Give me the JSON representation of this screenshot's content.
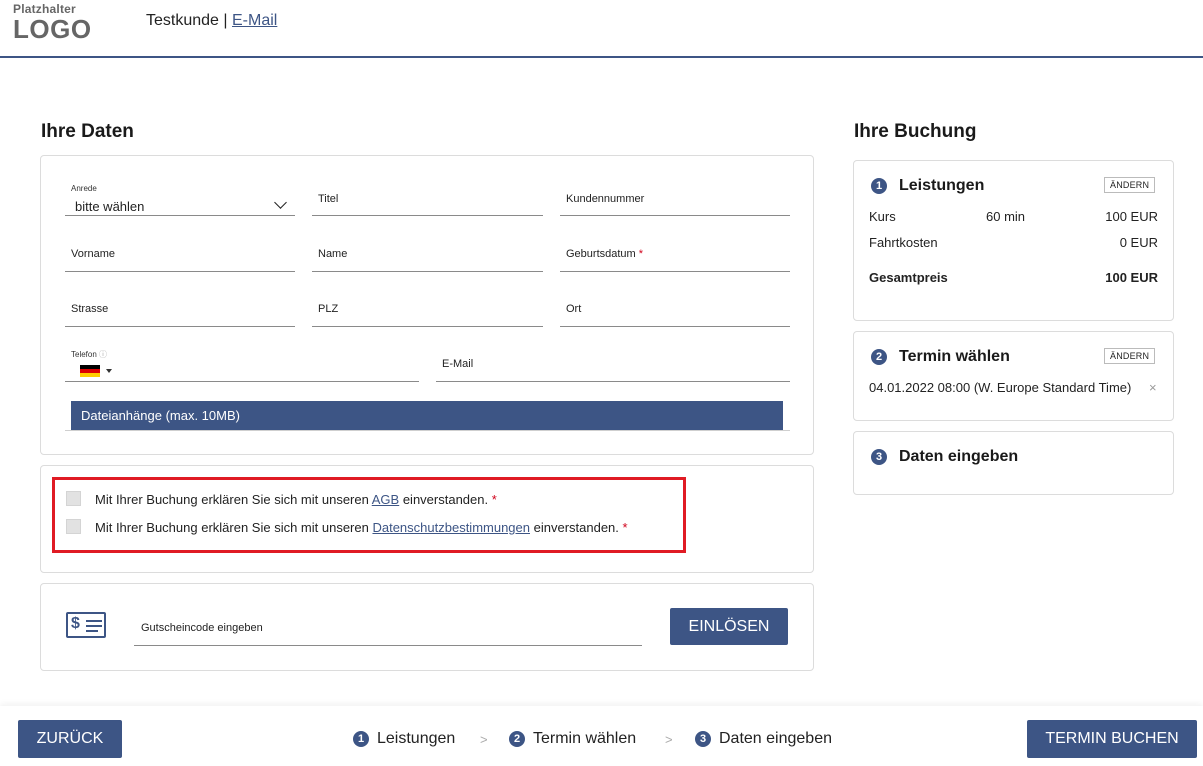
{
  "header": {
    "logo_line1": "Platzhalter",
    "logo_line2": "LOGO",
    "customer": "Testkunde",
    "separator": "|",
    "email_link": "E-Mail"
  },
  "form": {
    "title": "Ihre Daten",
    "anrede": {
      "label": "Anrede",
      "value": "bitte wählen"
    },
    "titel": {
      "label": "Titel"
    },
    "kundennummer": {
      "label": "Kundennummer"
    },
    "vorname": {
      "label": "Vorname"
    },
    "name": {
      "label": "Name"
    },
    "geburtsdatum": {
      "label": "Geburtsdatum",
      "required": "*"
    },
    "strasse": {
      "label": "Strasse"
    },
    "plz": {
      "label": "PLZ"
    },
    "ort": {
      "label": "Ort"
    },
    "telefon": {
      "label": "Telefon",
      "info": "ⓘ"
    },
    "email": {
      "label": "E-Mail"
    },
    "attachments": "Dateianhänge (max. 10MB)"
  },
  "consents": {
    "agb": {
      "before": "Mit Ihrer Buchung erklären Sie sich mit unseren ",
      "link": "AGB",
      "after": " einverstanden.",
      "required": "*"
    },
    "privacy": {
      "before": "Mit Ihrer Buchung erklären Sie sich mit unseren ",
      "link": "Datenschutzbestimmungen",
      "after": " einverstanden.",
      "required": "*"
    }
  },
  "voucher": {
    "icon_symbol": "$",
    "placeholder": "Gutscheincode eingeben",
    "button": "EINLÖSEN"
  },
  "booking": {
    "title": "Ihre Buchung",
    "change_label": "ÄNDERN",
    "services": {
      "step": "1",
      "title": "Leistungen",
      "rows": [
        {
          "name": "Kurs",
          "duration": "60 min",
          "price": "100 EUR"
        },
        {
          "name": "Fahrtkosten",
          "duration": "",
          "price": "0 EUR"
        }
      ],
      "total_label": "Gesamtpreis",
      "total_value": "100 EUR"
    },
    "appointment": {
      "step": "2",
      "title": "Termin wählen",
      "value": "04.01.2022 08:00 (W. Europe Standard Time)",
      "remove": "×"
    },
    "data": {
      "step": "3",
      "title": "Daten eingeben"
    }
  },
  "footer": {
    "back": "ZURÜCK",
    "steps": [
      {
        "num": "1",
        "label": "Leistungen"
      },
      {
        "num": "2",
        "label": "Termin wählen"
      },
      {
        "num": "3",
        "label": "Daten eingeben"
      }
    ],
    "separator": ">",
    "submit": "TERMIN BUCHEN"
  },
  "colors": {
    "primary": "#3d5585",
    "highlight": "#e01b24",
    "required": "#d0021b"
  }
}
